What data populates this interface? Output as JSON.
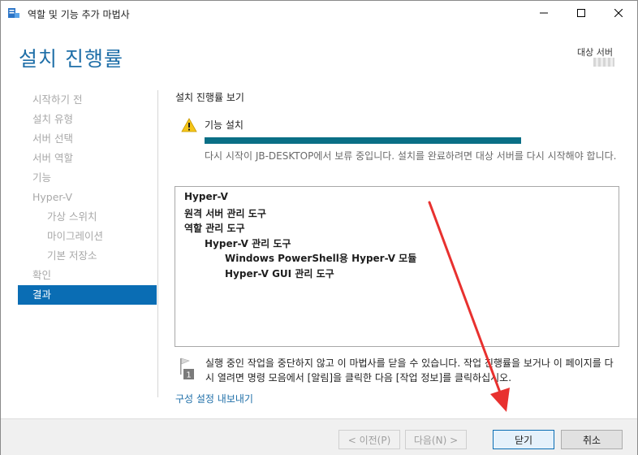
{
  "window": {
    "title": "역할 및 기능 추가 마법사",
    "icons": {
      "app": "server-manager-icon",
      "minimize": "minimize-icon",
      "maximize": "maximize-icon",
      "close": "close-icon"
    }
  },
  "header": {
    "title": "설치 진행률",
    "target_label": "대상 서버"
  },
  "nav": {
    "items": [
      {
        "label": "시작하기 전",
        "level": 0,
        "active": false
      },
      {
        "label": "설치 유형",
        "level": 0,
        "active": false
      },
      {
        "label": "서버 선택",
        "level": 0,
        "active": false
      },
      {
        "label": "서버 역할",
        "level": 0,
        "active": false
      },
      {
        "label": "기능",
        "level": 0,
        "active": false
      },
      {
        "label": "Hyper-V",
        "level": 0,
        "active": false
      },
      {
        "label": "가상 스위치",
        "level": 1,
        "active": false
      },
      {
        "label": "마이그레이션",
        "level": 1,
        "active": false
      },
      {
        "label": "기본 저장소",
        "level": 1,
        "active": false
      },
      {
        "label": "확인",
        "level": 0,
        "active": false
      },
      {
        "label": "결과",
        "level": 0,
        "active": true
      }
    ]
  },
  "content": {
    "heading": "설치 진행률 보기",
    "status_icon": "warning-icon",
    "feature_label": "기능 설치",
    "progress": 1.0,
    "status_message": "다시 시작이 JB-DESKTOP에서 보류 중입니다. 설치를 완료하려면 대상 서버를 다시 시작해야 합니다.",
    "results": [
      {
        "text": "Hyper-V",
        "level": 0
      },
      {
        "text": "원격 서버 관리 도구",
        "level": 0
      },
      {
        "text": "역할 관리 도구",
        "level": 1
      },
      {
        "text": "Hyper-V 관리 도구",
        "level": 2
      },
      {
        "text": "Windows PowerShell용 Hyper-V 모듈",
        "level": 3
      },
      {
        "text": "Hyper-V GUI 관리 도구",
        "level": 3
      }
    ],
    "note_icon": "flag-notification-icon",
    "note_badge": "1",
    "note_text": "실행 중인 작업을 중단하지 않고 이 마법사를 닫을 수 있습니다. 작업 진행률을 보거나 이 페이지를 다시 열려면 명령 모음에서 [알림]을 클릭한 다음 [작업 정보]를 클릭하십시오.",
    "export_link": "구성 설정 내보내기"
  },
  "footer": {
    "prev": "< 이전(P)",
    "next": "다음(N) >",
    "close": "닫기",
    "cancel": "취소"
  },
  "colors": {
    "accent": "#0a6db4",
    "title": "#1f6fa8",
    "progress": "#0a6f86",
    "annotation": "#e8312f"
  }
}
